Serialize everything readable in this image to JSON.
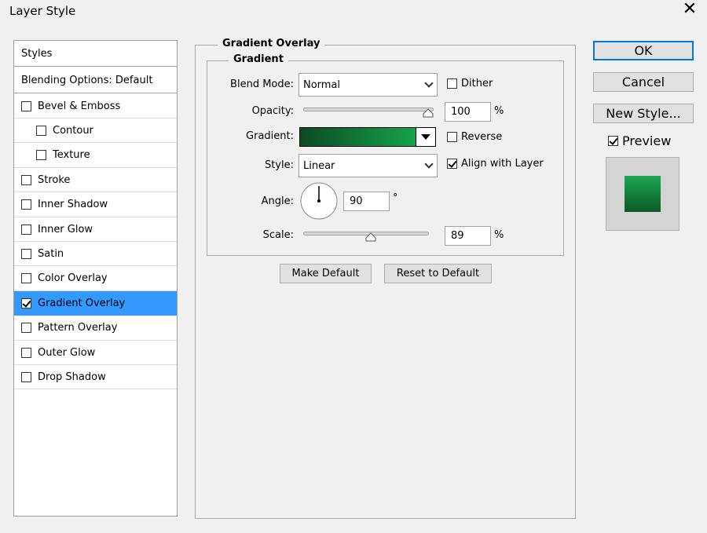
{
  "window": {
    "title": "Layer Style",
    "close_glyph": "✕"
  },
  "styles_panel": {
    "header": "Styles",
    "blending": "Blending Options: Default",
    "items": [
      {
        "label": "Bevel & Emboss",
        "checked": false,
        "indent": false
      },
      {
        "label": "Contour",
        "checked": false,
        "indent": true
      },
      {
        "label": "Texture",
        "checked": false,
        "indent": true
      },
      {
        "label": "Stroke",
        "checked": false,
        "indent": false
      },
      {
        "label": "Inner Shadow",
        "checked": false,
        "indent": false
      },
      {
        "label": "Inner Glow",
        "checked": false,
        "indent": false
      },
      {
        "label": "Satin",
        "checked": false,
        "indent": false
      },
      {
        "label": "Color Overlay",
        "checked": false,
        "indent": false
      },
      {
        "label": "Gradient Overlay",
        "checked": true,
        "indent": false,
        "selected": true
      },
      {
        "label": "Pattern Overlay",
        "checked": false,
        "indent": false
      },
      {
        "label": "Outer Glow",
        "checked": false,
        "indent": false
      },
      {
        "label": "Drop Shadow",
        "checked": false,
        "indent": false
      }
    ]
  },
  "gradient_overlay": {
    "section_title": "Gradient Overlay",
    "group_title": "Gradient",
    "blend_mode": {
      "label": "Blend Mode:",
      "value": "Normal"
    },
    "dither": {
      "label": "Dither",
      "checked": false
    },
    "opacity": {
      "label": "Opacity:",
      "value": "100",
      "unit": "%",
      "level": 1.0
    },
    "gradient": {
      "label": "Gradient:",
      "start_color": "#0b4a24",
      "end_color": "#16a34a"
    },
    "reverse": {
      "label": "Reverse",
      "checked": false
    },
    "style": {
      "label": "Style:",
      "value": "Linear"
    },
    "align_with_layer": {
      "label": "Align with Layer",
      "checked": true
    },
    "angle": {
      "label": "Angle:",
      "value": "90",
      "unit": "°"
    },
    "scale": {
      "label": "Scale:",
      "value": "89",
      "unit": "%",
      "level": 0.54
    },
    "make_default": "Make Default",
    "reset_to_default": "Reset to Default"
  },
  "actions": {
    "ok": "OK",
    "cancel": "Cancel",
    "new_style": "New Style...",
    "preview": {
      "label": "Preview",
      "checked": true
    }
  },
  "colors": {
    "selection": "#3399ff",
    "accent_border": "#0078d7"
  }
}
